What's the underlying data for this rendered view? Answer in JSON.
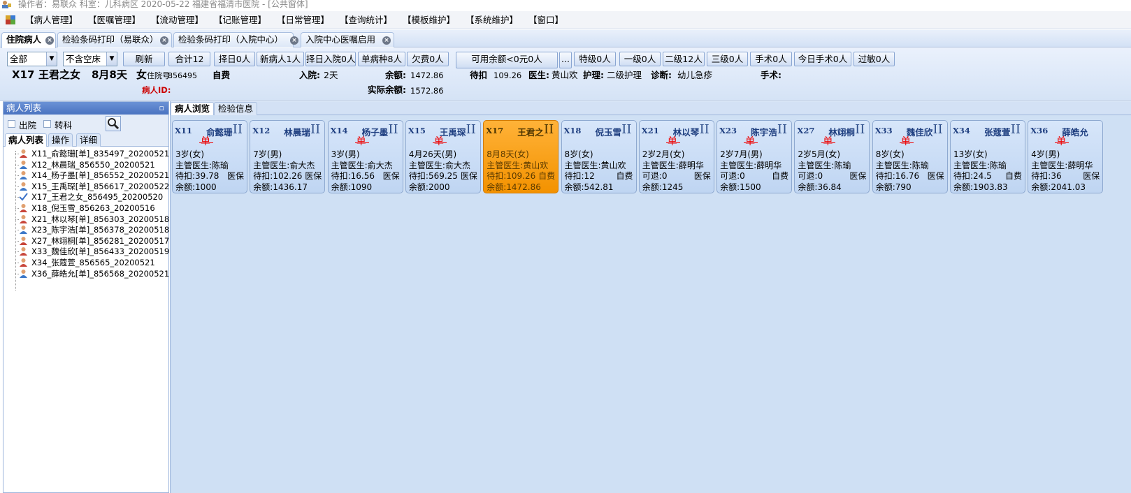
{
  "titlebar": {
    "text": "操作者：易联众  科室：儿科病区   2020-05-22   福建省福清市医院 - [公共窗体]"
  },
  "menu": [
    "【病人管理】",
    "【医嘱管理】",
    "【流动管理】",
    "【记账管理】",
    "【日常管理】",
    "【查询统计】",
    "【模板维护】",
    "【系统维护】",
    "【窗口】"
  ],
  "doc_tabs": [
    {
      "label": "住院病人",
      "active": true
    },
    {
      "label": "检验条码打印（易联众）",
      "active": false
    },
    {
      "label": "检验条码打印（入院中心）",
      "active": false
    },
    {
      "label": "入院中心医嘱启用",
      "active": false
    }
  ],
  "toolbar": {
    "filter_all": "全部",
    "filter_bed": "不含空床",
    "buttons": [
      "刷新",
      "合计12",
      "择日0人",
      "新病人1人",
      "择日入院0人",
      "单病种8人",
      "欠费0人",
      "可用余额<0元0人",
      "...",
      "特级0人",
      "一级0人",
      "二级12人",
      "三级0人",
      "手术0人",
      "今日手术0人",
      "过敏0人"
    ]
  },
  "patient_info": {
    "bed": "X17",
    "name": "王君之女",
    "age": "8月8天",
    "sex": "女",
    "hosp_no_label": "住院号:",
    "hosp_no": "856495",
    "fee_type": "自费",
    "admit_label": "入院:",
    "admit_days": "2天",
    "balance_label": "余额:",
    "balance": "1472.86",
    "pending_label": "待扣",
    "pending": "109.26",
    "doctor_label": "医生:",
    "doctor": "黄山欢",
    "nursing_label": "护理:",
    "nursing": "二级护理",
    "diagnosis_label": "诊断:",
    "diagnosis": "幼儿急疹",
    "surgery_label": "手术:",
    "patient_id_label": "病人ID:",
    "actual_balance_label": "实际余额:",
    "actual_balance": "1572.86"
  },
  "left_panel": {
    "title": "病人列表",
    "pin": "ᵠ",
    "discharged": "出院",
    "transfer": "转科",
    "tabs": [
      "病人列表",
      "操作",
      "详细"
    ],
    "patients": [
      {
        "label": "X11_俞懿珊[单]_835497_20200521",
        "gender": "f"
      },
      {
        "label": "X12_林晨瑞_856550_20200521",
        "gender": "m"
      },
      {
        "label": "X14_杨子墨[单]_856552_20200521",
        "gender": "m"
      },
      {
        "label": "X15_王禹琛[单]_856617_20200522",
        "gender": "m"
      },
      {
        "label": "X17_王君之女_856495_20200520",
        "gender": "check"
      },
      {
        "label": "X18_倪玉雪_856263_20200516",
        "gender": "f"
      },
      {
        "label": "X21_林以琴[单]_856303_20200518",
        "gender": "f"
      },
      {
        "label": "X23_陈宇浩[单]_856378_20200518",
        "gender": "m"
      },
      {
        "label": "X27_林翊桐[单]_856281_20200517",
        "gender": "f"
      },
      {
        "label": "X33_魏佳欣[单]_856433_20200519",
        "gender": "f"
      },
      {
        "label": "X34_张蔻萱_856565_20200521",
        "gender": "f"
      },
      {
        "label": "X36_薛皓允[单]_856568_20200521",
        "gender": "m"
      }
    ]
  },
  "main_tabs": [
    "病人浏览",
    "检验信息"
  ],
  "cards": [
    {
      "bed": "X11",
      "name": "俞懿珊",
      "level": "II",
      "single": "单",
      "age": "3岁(女)",
      "doctor_label": "主管医生:",
      "doctor": "陈瑜",
      "pending_label": "待扣:",
      "pending": "39.78",
      "insurance": "医保",
      "balance_label": "余额:",
      "balance": "1000",
      "selected": false
    },
    {
      "bed": "X12",
      "name": "林晨瑞",
      "level": "II",
      "single": "",
      "age": "7岁(男)",
      "doctor_label": "主管医生:",
      "doctor": "俞大杰",
      "pending_label": "待扣:",
      "pending": "102.26",
      "insurance": "医保",
      "balance_label": "余额:",
      "balance": "1436.17",
      "selected": false
    },
    {
      "bed": "X14",
      "name": "杨子墨",
      "level": "II",
      "single": "单",
      "age": "3岁(男)",
      "doctor_label": "主管医生:",
      "doctor": "俞大杰",
      "pending_label": "待扣:",
      "pending": "16.56",
      "insurance": "医保",
      "balance_label": "余额:",
      "balance": "1090",
      "selected": false
    },
    {
      "bed": "X15",
      "name": "王禹琛",
      "level": "II",
      "single": "单",
      "age": "4月26天(男)",
      "doctor_label": "主管医生:",
      "doctor": "俞大杰",
      "pending_label": "待扣:",
      "pending": "569.25",
      "insurance": "医保",
      "balance_label": "余额:",
      "balance": "2000",
      "selected": false
    },
    {
      "bed": "X17",
      "name": "王君之",
      "level": "II",
      "single": "",
      "age": "8月8天(女)",
      "doctor_label": "主管医生:",
      "doctor": "黄山欢",
      "pending_label": "待扣:",
      "pending": "109.26",
      "insurance": "自费",
      "balance_label": "余额:",
      "balance": "1472.86",
      "selected": true
    },
    {
      "bed": "X18",
      "name": "倪玉雪",
      "level": "II",
      "single": "",
      "age": "8岁(女)",
      "doctor_label": "主管医生:",
      "doctor": "黄山欢",
      "pending_label": "待扣:",
      "pending": "12",
      "insurance": "自费",
      "balance_label": "余额:",
      "balance": "542.81",
      "selected": false
    },
    {
      "bed": "X21",
      "name": "林以琴",
      "level": "II",
      "single": "单",
      "age": "2岁2月(女)",
      "doctor_label": "主管医生:",
      "doctor": "薛明华",
      "pending_label": "可退:",
      "pending": "0",
      "insurance": "医保",
      "balance_label": "余额:",
      "balance": "1245",
      "selected": false
    },
    {
      "bed": "X23",
      "name": "陈宇浩",
      "level": "II",
      "single": "单",
      "age": "2岁7月(男)",
      "doctor_label": "主管医生:",
      "doctor": "薛明华",
      "pending_label": "可退:",
      "pending": "0",
      "insurance": "自费",
      "balance_label": "余额:",
      "balance": "1500",
      "selected": false
    },
    {
      "bed": "X27",
      "name": "林翊桐",
      "level": "II",
      "single": "单",
      "age": "2岁5月(女)",
      "doctor_label": "主管医生:",
      "doctor": "陈瑜",
      "pending_label": "可退:",
      "pending": "0",
      "insurance": "医保",
      "balance_label": "余额:",
      "balance": "36.84",
      "selected": false
    },
    {
      "bed": "X33",
      "name": "魏佳欣",
      "level": "II",
      "single": "单",
      "age": "8岁(女)",
      "doctor_label": "主管医生:",
      "doctor": "陈瑜",
      "pending_label": "待扣:",
      "pending": "16.76",
      "insurance": "医保",
      "balance_label": "余额:",
      "balance": "790",
      "selected": false
    },
    {
      "bed": "X34",
      "name": "张蔻萱",
      "level": "II",
      "single": "",
      "age": "13岁(女)",
      "doctor_label": "主管医生:",
      "doctor": "陈瑜",
      "pending_label": "待扣:",
      "pending": "24.5",
      "insurance": "自费",
      "balance_label": "余额:",
      "balance": "1903.83",
      "selected": false
    },
    {
      "bed": "X36",
      "name": "薛皓允",
      "level": "",
      "single": "单",
      "age": "4岁(男)",
      "doctor_label": "主管医生:",
      "doctor": "薛明华",
      "pending_label": "待扣:",
      "pending": "36",
      "insurance": "医保",
      "balance_label": "余额:",
      "balance": "2041.03",
      "selected": false
    }
  ],
  "colors": {
    "selected_card": "#f39200",
    "card_bg": "#c9dcf5",
    "single_mark": "#e00000",
    "panel_header": "#4a73c0"
  }
}
